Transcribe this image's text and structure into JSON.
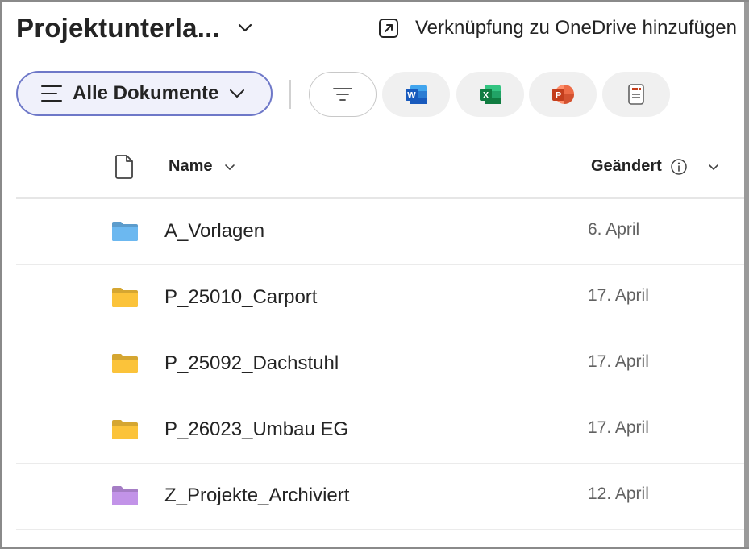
{
  "header": {
    "title": "Projektunterla...",
    "shortcut_label": "Verknüpfung zu OneDrive hinzufügen"
  },
  "toolbar": {
    "view_label": "Alle Dokumente",
    "buttons": [
      {
        "icon": "filter-icon"
      },
      {
        "icon": "word-icon",
        "letter": "W"
      },
      {
        "icon": "excel-icon",
        "letter": "X"
      },
      {
        "icon": "powerpoint-icon",
        "letter": "P"
      },
      {
        "icon": "forms-icon"
      }
    ]
  },
  "table": {
    "columns": {
      "name": "Name",
      "modified": "Geändert"
    },
    "rows": [
      {
        "name": "A_Vorlagen",
        "modified": "6. April",
        "folder_color": "#6cb8f0"
      },
      {
        "name": "P_25010_Carport",
        "modified": "17. April",
        "folder_color": "#fbc33a"
      },
      {
        "name": "P_25092_Dachstuhl",
        "modified": "17. April",
        "folder_color": "#fbc33a"
      },
      {
        "name": "P_26023_Umbau EG",
        "modified": "17. April",
        "folder_color": "#fbc33a"
      },
      {
        "name": "Z_Projekte_Archiviert",
        "modified": "12. April",
        "folder_color": "#c293e8"
      }
    ]
  },
  "colors": {
    "accent": "#6e78c8",
    "word": "#185abd",
    "excel": "#107c41",
    "powerpoint": "#c43e1c"
  }
}
